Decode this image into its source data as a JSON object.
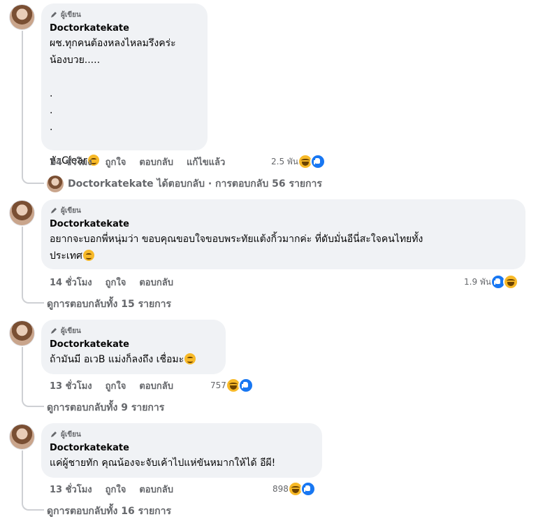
{
  "badge_label": "ผู้เขียน",
  "actions": {
    "like": "ถูกใจ",
    "reply": "ตอบกลับ",
    "edited": "แก้ไขแล้ว"
  },
  "comments": [
    {
      "author": "Doctorkatekate",
      "text": "ผช.ทุกคนต้องหลงไหลมรึงคร่ะ\nน้องบวย.....\n\n.\n.\n.\n\nหัวClear",
      "time": "14 ชั่วโมง",
      "reactions_count": "2.5 พัน",
      "reaction_icons": [
        "haha-icon",
        "like-icon"
      ],
      "replies_text": "Doctorkatekate ได้ตอบกลับ · การตอบกลับ 56 รายการ"
    },
    {
      "author": "Doctorkatekate",
      "text": "อยากจะบอกพี่หนุ่มว่า ขอบคุณขอบใจขอบพระทัยแต้งกิ้วมากค่ะ ที่ดับมั่นอีนี่สะใจคนไทยทั้ง\nประเทศ",
      "time": "14 ชั่วโมง",
      "reactions_count": "1.9 พัน",
      "reaction_icons": [
        "like-icon",
        "haha-icon"
      ],
      "replies_text": "ดูการตอบกลับทั้ง 15 รายการ"
    },
    {
      "author": "Doctorkatekate",
      "text": "ถ้ามันมี อเวB แม่งก็ลงถึง เชื่อมะ",
      "time": "13 ชั่วโมง",
      "reactions_count": "757",
      "reaction_icons": [
        "haha-icon",
        "like-icon"
      ],
      "replies_text": "ดูการตอบกลับทั้ง 9 รายการ"
    },
    {
      "author": "Doctorkatekate",
      "text": "แค่ผู้ชายทัก คุณน้องจะจับเค้าไปแห่ขันหมากให้ได้ อีผี!",
      "time": "13 ชั่วโมง",
      "reactions_count": "898",
      "reaction_icons": [
        "haha-icon",
        "like-icon"
      ],
      "replies_text": "ดูการตอบกลับทั้ง 16 รายการ"
    }
  ]
}
